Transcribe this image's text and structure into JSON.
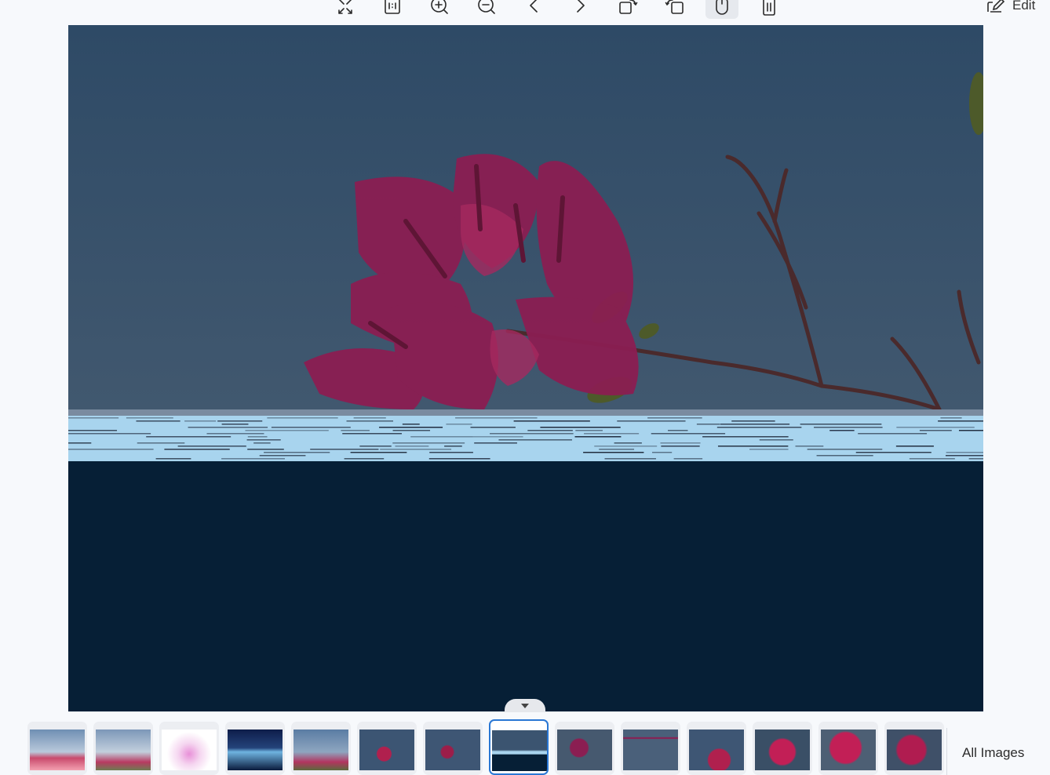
{
  "toolbar": {
    "buttons": [
      {
        "name": "fullscreen",
        "icon": "fullscreen-icon"
      },
      {
        "name": "actual-size",
        "icon": "actual-size-icon"
      },
      {
        "name": "zoom-in",
        "icon": "zoom-in-icon"
      },
      {
        "name": "zoom-out",
        "icon": "zoom-out-icon"
      },
      {
        "name": "previous",
        "icon": "chevron-left-icon"
      },
      {
        "name": "next",
        "icon": "chevron-right-icon"
      },
      {
        "name": "rotate-right",
        "icon": "rotate-right-icon"
      },
      {
        "name": "rotate-left",
        "icon": "rotate-left-icon"
      },
      {
        "name": "pointer-mode",
        "icon": "mouse-icon",
        "active": true
      },
      {
        "name": "delete",
        "icon": "trash-icon"
      }
    ],
    "edit_label": "Edit"
  },
  "filmstrip": {
    "selected_index": 7,
    "all_images_label": "All Images",
    "thumbnails": 14
  },
  "colors": {
    "accent": "#2a77d4",
    "sky": "#3b5470",
    "flower": "#8b1e52",
    "dark_band": "#061f36"
  }
}
